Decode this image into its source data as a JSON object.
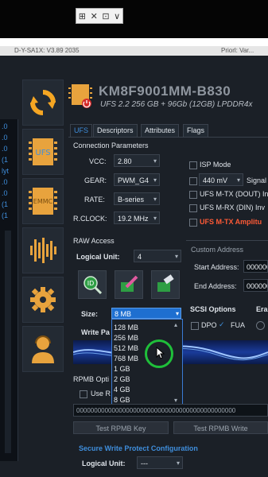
{
  "window": {
    "controls": [
      "⊞",
      "✕",
      "⊡",
      "∨"
    ],
    "tab_left": "D-Y-SA1X: V3.89 2035",
    "tab_right": "Priorl: Var..."
  },
  "tree": {
    "items": [
      ".0",
      ".0",
      ".0",
      "(1",
      "lyt",
      ".0",
      ".0",
      "(1",
      "(1"
    ]
  },
  "header": {
    "title": "KM8F9001MM-B830",
    "subtitle": "UFS 2.2  256 GB + 96Gb (12GB) LPDDR4x"
  },
  "sidebar": {
    "items": [
      "ufs-chip",
      "emmc-chip",
      "waveform",
      "settings-gear",
      "user-support"
    ]
  },
  "tabs": [
    {
      "label": "UFS",
      "active": true
    },
    {
      "label": "Descriptors",
      "active": false
    },
    {
      "label": "Attributes",
      "active": false
    },
    {
      "label": "Flags",
      "active": false
    }
  ],
  "connection": {
    "heading": "Connection Parameters",
    "vcc_label": "VCC:",
    "vcc_value": "2.80",
    "gear_label": "GEAR:",
    "gear_value": "PWM_G4",
    "rate_label": "RATE:",
    "rate_value": "B-series",
    "rclock_label": "R.CLOCK:",
    "rclock_value": "19.2 MHz"
  },
  "right_options": {
    "isp_mode": "ISP Mode",
    "mv_value": "440 mV",
    "signal": "Signal",
    "ufs_mtx": "UFS M-TX (DOUT) In",
    "ufs_mrx": "UFS M-RX (DIN) Inv",
    "ufs_mtx_ampl": "UFS M-TX Amplitu"
  },
  "raw_access": {
    "heading": "RAW Access",
    "logical_unit_label": "Logical Unit:",
    "logical_unit_value": "4",
    "size_label": "Size:",
    "size_value": "8 MB",
    "write_pattern_label": "Write Pa"
  },
  "custom_address": {
    "heading": "Custom Address",
    "start_label": "Start Address:",
    "start_value": "000000",
    "end_label": "End Address:",
    "end_value": "000000"
  },
  "scsi": {
    "heading": "SCSI Options",
    "dpo": "DPO",
    "fua": "FUA",
    "erase_heading": "Era"
  },
  "size_options": [
    "128 MB",
    "256 MB",
    "512 MB",
    "768 MB",
    "1 GB",
    "2 GB",
    "4 GB",
    "8 GB"
  ],
  "rpmb": {
    "heading": "RPMB Opti",
    "use_label": "Use R",
    "hex_value": "000000000000000000000000000000000000000000000",
    "test_key_button": "Test RPMB Key",
    "test_write_button": "Test RPMB Write"
  },
  "secure_write": {
    "heading": "Secure Write Protect Configuration",
    "logical_unit_label": "Logical Unit:",
    "logical_unit_value": "---"
  },
  "colors": {
    "accent_blue": "#3f8edc",
    "warning_red": "#ff5a36",
    "selected_blue": "#1e6fd0",
    "cursor_ring": "#1fbf3a"
  }
}
